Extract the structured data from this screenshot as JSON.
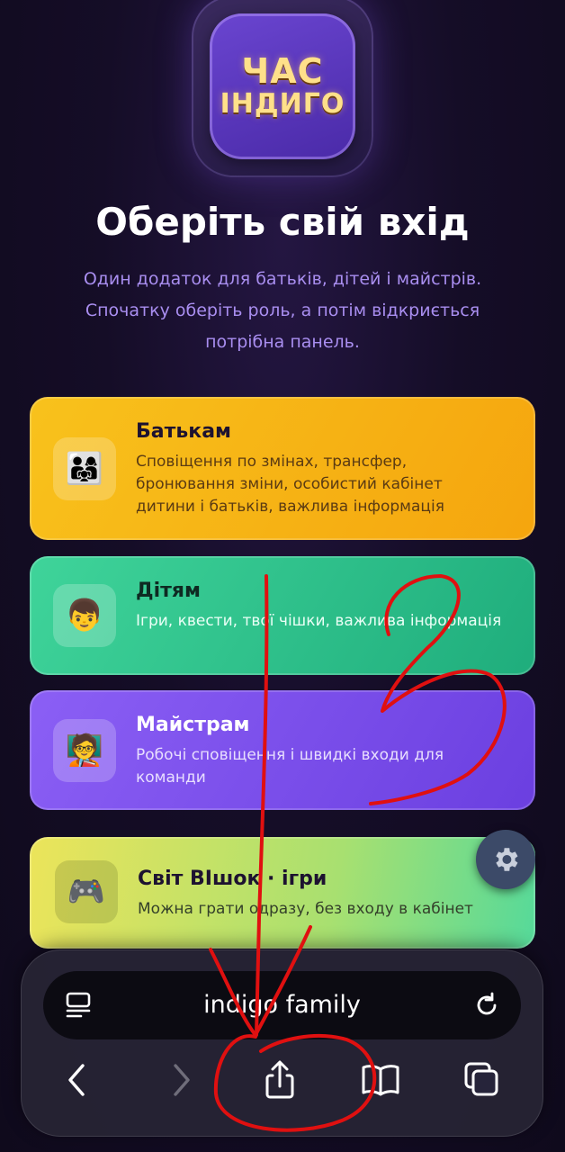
{
  "logo": {
    "line1": "ЧАС",
    "line2": "ІНДИГО"
  },
  "title": "Оберіть свій вхід",
  "subtitle": "Один додаток для батьків, дітей і майстрів. Спочатку оберіть роль, а потім відкриється потрібна панель.",
  "cards": [
    {
      "title": "Батькам",
      "description": "Сповіщення по змінах, трансфер, бронювання зміни, особистий кабінет дитини і батьків, важлива інформація",
      "icon": "family-emoji-icon",
      "emoji": "👨‍👩‍👧"
    },
    {
      "title": "Дітям",
      "description": "Ігри, квести, твої чішки, важлива інформація",
      "icon": "child-emoji-icon",
      "emoji": "👦"
    },
    {
      "title": "Майстрам",
      "description": "Робочі сповіщення і швидкі входи для команди",
      "icon": "teacher-emoji-icon",
      "emoji": "🧑‍🏫"
    },
    {
      "title": "Світ ВІшок · ігри",
      "description": "Можна грати одразу, без входу в кабінет",
      "icon": "gamepad-emoji-icon",
      "emoji": "🎮"
    }
  ],
  "settings": {
    "icon": "gear-icon"
  },
  "browser": {
    "url": "indigo family",
    "toolbar": [
      "back-icon",
      "forward-icon",
      "share-icon",
      "bookmarks-icon",
      "tabs-icon"
    ]
  },
  "colors": {
    "background": "#150d27",
    "accent_text": "#a98ef0",
    "parents_card": "#f8c21c",
    "kids_card": "#2fc08b",
    "masters_card": "#7b4ff0",
    "games_card": "#c5e25f",
    "annotation_ink": "#e01010"
  }
}
